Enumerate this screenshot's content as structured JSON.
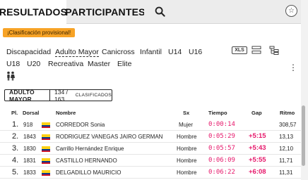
{
  "tabs": {
    "resultados": "RESULTADOS",
    "participantes": "PARTICIPANTES",
    "search_icon": "search-icon",
    "star_icon": "star-icon"
  },
  "badge": "¡Clasificación provisional!",
  "categories": {
    "discapacidad": "Discapacidad",
    "adulto_mayor": "Adulto Mayor",
    "canicross": "Canicross",
    "infantil": "Infantil",
    "u14": "U14",
    "u16": "U16",
    "u18": "U18",
    "u20": "U20",
    "recreativa": "Recreativa",
    "master": "Master",
    "elite": "Elite"
  },
  "tools": {
    "xls": "XLS",
    "list_icon": "list-view-icon",
    "tree_icon": "tree-view-icon",
    "more_icon": "more-vertical-icon",
    "people_icon": "people-icon"
  },
  "summary": {
    "category": "ADULTO MAYOR",
    "count": "134 / 163",
    "label": "CLASIFICADOS"
  },
  "table": {
    "headers": {
      "pl": "Pl.",
      "dorsal": "Dorsal",
      "nombre": "Nombre",
      "sx": "Sx",
      "tiempo": "Tiempo",
      "gap": "Gap",
      "ritmo": "Ritmo"
    },
    "flag_colors": [
      "#fcd116",
      "#003893",
      "#ce1126"
    ],
    "rows": [
      {
        "pl": "1.",
        "dorsal": "918",
        "nombre": "CORREDOR Sonia",
        "sx": "Mujer",
        "tiempo": "0:00:14",
        "gap": "",
        "ritmo": "308,57"
      },
      {
        "pl": "2.",
        "dorsal": "1843",
        "nombre": "RODRIGUEZ VANEGAS JAIRO GERMAN",
        "sx": "Hombre",
        "tiempo": "0:05:29",
        "gap": "+5:15",
        "ritmo": "13,13"
      },
      {
        "pl": "3.",
        "dorsal": "1830",
        "nombre": "Carrillo Hernández Enrique",
        "sx": "Hombre",
        "tiempo": "0:05:57",
        "gap": "+5:43",
        "ritmo": "12,10"
      },
      {
        "pl": "4.",
        "dorsal": "1831",
        "nombre": "CASTILLO HERNANDO",
        "sx": "Hombre",
        "tiempo": "0:06:09",
        "gap": "+5:55",
        "ritmo": "11,71"
      },
      {
        "pl": "5.",
        "dorsal": "1833",
        "nombre": "DELGADILLO MAURICIO",
        "sx": "Hombre",
        "tiempo": "0:06:22",
        "gap": "+6:08",
        "ritmo": "11,31"
      }
    ]
  }
}
